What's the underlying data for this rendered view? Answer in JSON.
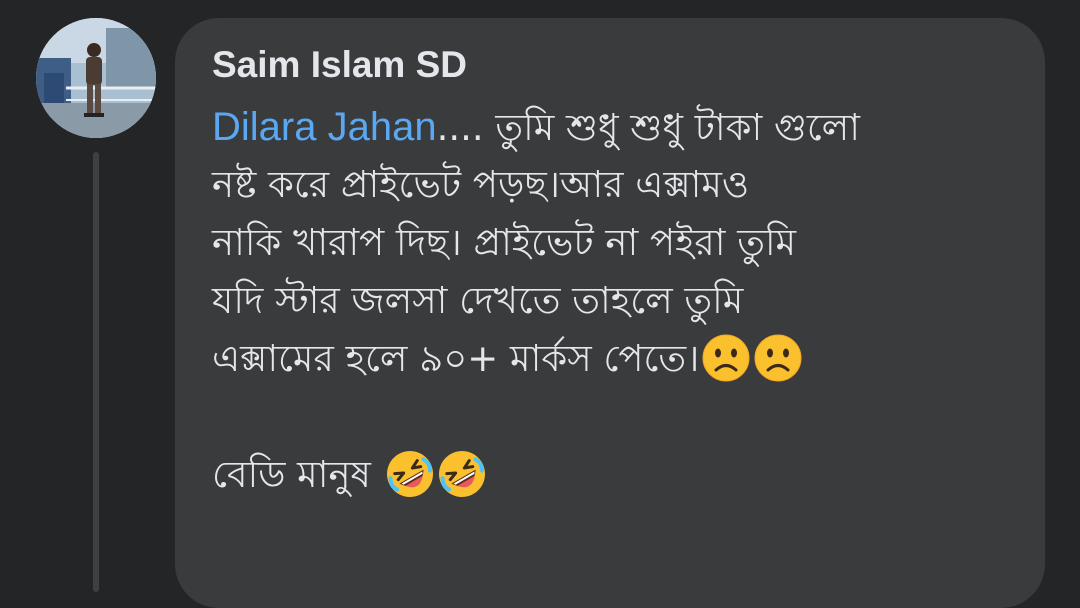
{
  "comment": {
    "author": "Saim Islam SD",
    "mention": "Dilara Jahan",
    "lines": [
      ".... তুমি শুধু শুধু টাকা গুলো",
      "নষ্ট করে প্রাইভেট পড়ছ।আর এক্সামও",
      "নাকি খারাপ দিছ। প্রাইভেট না পইরা তুমি",
      "যদি স্টার জলসা দেখতে তাহলে তুমি",
      "এক্সামের হলে ৯০+ মার্কস পেতে।",
      "বেডি মানুষ "
    ],
    "emojis": {
      "line5": [
        "frowning-face",
        "frowning-face"
      ],
      "line6": [
        "rolling-on-the-floor-laughing",
        "rolling-on-the-floor-laughing"
      ]
    }
  },
  "colors": {
    "background": "#242526",
    "bubble": "#3a3b3c",
    "text": "#e4e6eb",
    "mention": "#5aa7f2",
    "thread_line": "#3e4042"
  }
}
